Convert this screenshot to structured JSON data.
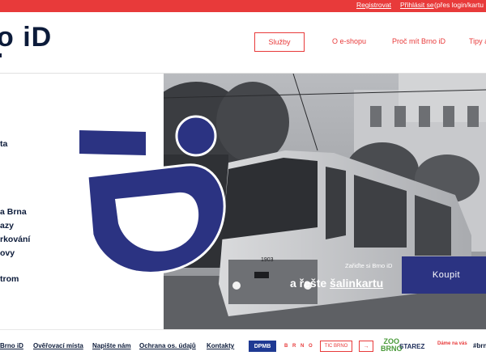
{
  "topbar": {
    "register": "Registrovat",
    "login": "Přihlásit se",
    "login_note": "(přes login/kartu"
  },
  "header": {
    "logo": "o iD",
    "nav": {
      "services": "Služby",
      "eshop": "O e-shopu",
      "why": "Proč mít Brno iD",
      "tips": "Tipy a"
    }
  },
  "left_column": [
    "ta",
    "a Brna",
    "azy",
    "rkování",
    "ovy",
    "trom"
  ],
  "hero": {
    "small_text": "Zařiďte si Brno iD",
    "big_text_prefix": "a řešte ",
    "big_text_link": "šalinkartu",
    "buy_button": "Koupit",
    "tram_number": "1903"
  },
  "footer": {
    "links": {
      "brno_id": "Brno iD",
      "overovaci": "Ověřovací místa",
      "napiste": "Napište nám",
      "ochrana": "Ochrana os. údajů",
      "kontakty": "Kontakty"
    },
    "partners": {
      "dpmb": "DPMB",
      "brno": "B R N O",
      "tic": "TIC BRNO",
      "tic_arrow": "→",
      "zoo_line1": "ZOO",
      "zoo_line2": "BRNO",
      "starez": "STAREZ",
      "dame": "Dáme na vás",
      "brno_tag": "#brn"
    }
  },
  "colors": {
    "accent_red": "#e83a3a",
    "brand_navy": "#2b3382",
    "text_navy": "#0c1b3a"
  }
}
